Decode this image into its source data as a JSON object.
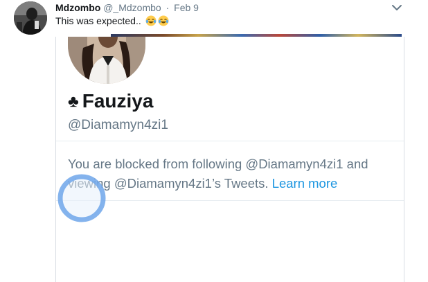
{
  "tweet": {
    "author_name": "Mdzombo",
    "author_handle": "@_Mdzombo",
    "separator": "·",
    "date": "Feb 9",
    "text": "This was expected.. ",
    "emojis": [
      "face-with-tears-of-joy",
      "face-with-tears-of-joy"
    ],
    "menu_icon": "chevron-down-icon"
  },
  "embed": {
    "profile_name": "Fauziya",
    "name_icon": "♣",
    "profile_handle": "@Diamamyn4zi1",
    "blocked_message": "You are blocked from following @Diamamyn4zi1 and viewing @Diamamyn4zi1’s Tweets.",
    "learn_more_label": "Learn more"
  },
  "colors": {
    "link": "#1b95e0",
    "secondary_text": "#657786",
    "primary_text": "#14171a",
    "touch_indicator": "#5b9be6"
  }
}
